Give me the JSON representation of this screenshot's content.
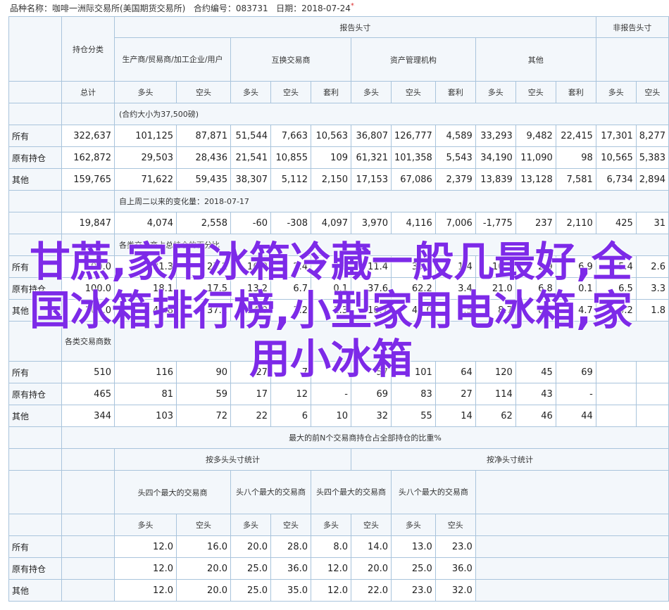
{
  "header": {
    "commodity": "品种名称：咖啡一洲际交易所(美国期货交易所)",
    "contract": "合约编号：083731",
    "date": "日期：2018-07-24",
    "mark": "*"
  },
  "table": {
    "col_group": {
      "report": "报告头寸",
      "nonreport": "非报告头寸"
    },
    "holding": "持仓分类",
    "sub_groups": {
      "producer": "生产商/贸易商/加工企业/用户",
      "swap": "互换交易商",
      "managed": "资产管理机构",
      "other": "其他"
    },
    "total_label": "总计",
    "pos_labels": {
      "long": "多头",
      "short": "空头",
      "spread": "套利"
    },
    "section1_note": "(合约大小为37,500磅)",
    "rows1": [
      {
        "label": "所有",
        "values": [
          "322,637",
          "101,125",
          "87,871",
          "51,544",
          "7,663",
          "10,563",
          "36,807",
          "126,777",
          "4,589",
          "33,293",
          "9,482",
          "22,415",
          "17,301",
          "8,277"
        ]
      },
      {
        "label": "原有持仓",
        "values": [
          "162,872",
          "29,503",
          "28,436",
          "21,541",
          "10,855",
          "109",
          "61,321",
          "101,358",
          "5,543",
          "34,190",
          "11,090",
          "98",
          "10,565",
          "5,383"
        ]
      },
      {
        "label": "其他",
        "values": [
          "159,765",
          "71,622",
          "59,435",
          "38,307",
          "5,112",
          "2,150",
          "17,153",
          "67,086",
          "2,379",
          "13,839",
          "13,128",
          "7,581",
          "6,734",
          "2,894"
        ]
      }
    ],
    "section2_note": "自上周二以来的变化量：2018-07-17",
    "changes": [
      "19,847",
      "4,074",
      "2,558",
      "-60",
      "-308",
      "4,097",
      "3,970",
      "4,116",
      "7,006",
      "-1,775",
      "237",
      "2,110",
      "425",
      "31"
    ],
    "section3_note": "各类交易商占总持仓的百分比",
    "rows3": [
      {
        "label": "所有",
        "values": [
          "100.0",
          "31.3",
          "27.2",
          "16.0",
          "2.4",
          "3.3",
          "11.4",
          "39.3",
          "1.4",
          "10.3",
          "2.9",
          "6.9",
          "5.4",
          "2.6"
        ]
      },
      {
        "label": "原有持仓",
        "values": [
          "100.0",
          "18.1",
          "17.5",
          "13.2",
          "6.7",
          "0.1",
          "37.6",
          "62.2",
          "3.4",
          "21.0",
          "6.8",
          "0.1",
          "6.5",
          "3.3"
        ]
      },
      {
        "label": "其他",
        "values": [
          "100.0",
          "44.8",
          "37.2",
          "24.0",
          "3.2",
          "1.3",
          "10.7",
          "42.0",
          "1.5",
          "8.7",
          "8.2",
          "4.7",
          "4.2",
          "1.8"
        ]
      }
    ],
    "section4_note": "各类交易商数",
    "rows4": [
      {
        "label": "所有",
        "values": [
          "510",
          "116",
          "90",
          "27",
          "7",
          "",
          "57",
          "101",
          "64",
          "120",
          "45",
          "69",
          "",
          ""
        ]
      },
      {
        "label": "原有持仓",
        "values": [
          "465",
          "81",
          "59",
          "17",
          "12",
          "-",
          "69",
          "83",
          "27",
          "114",
          "43",
          "-",
          "",
          ""
        ]
      },
      {
        "label": "其他",
        "values": [
          "344",
          "103",
          "72",
          "22",
          "6",
          "10",
          "32",
          "55",
          "14",
          "62",
          "46",
          "44",
          "",
          ""
        ]
      }
    ],
    "conc_title": "最大的前N个交易商持仓占全部持仓的比重%",
    "conc_gross": "按多头头寸统计",
    "conc_net": "按净头寸统计",
    "conc_cols": [
      "头四个最大的交易商",
      "头八个最大的交易商",
      "头四个最大的交易商",
      "头八个最大的交易商"
    ],
    "conc_rows": [
      {
        "label": "所有",
        "values": [
          "12.0",
          "16.0",
          "20.0",
          "28.0",
          "8.0",
          "14.0",
          "13.0",
          "23.0"
        ]
      },
      {
        "label": "原有持仓",
        "values": [
          "12.0",
          "20.0",
          "25.0",
          "36.0",
          "12.0",
          "20.0",
          "25.0",
          "36.0"
        ]
      },
      {
        "label": "其他",
        "values": [
          "12.0",
          "20.0",
          "25.0",
          "35.0",
          "12.0",
          "22.0",
          "23.0",
          "32.0"
        ]
      }
    ]
  },
  "overlay_text": "甘蔗,家用冰箱冷藏一般几最好,全国冰箱排行榜,小型家用电冰箱,家用小冰箱"
}
